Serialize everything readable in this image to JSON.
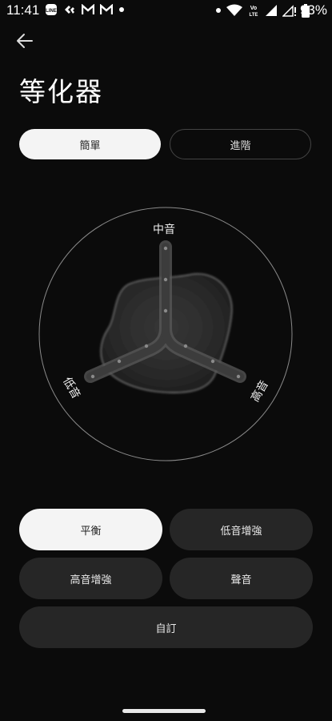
{
  "status_bar": {
    "time": "11:41",
    "battery": "93%",
    "left_icons": [
      "line-icon",
      "wallet-icon",
      "gmail-icon",
      "gmail-icon",
      "dot-icon"
    ],
    "right_icons": [
      "dot-icon",
      "wifi-icon",
      "volte-icon",
      "signal-icon",
      "signal-alert-icon",
      "battery-icon"
    ]
  },
  "header": {
    "back_icon": "arrow-left-icon",
    "title": "等化器"
  },
  "mode_tabs": {
    "simple": "簡單",
    "advanced": "進階",
    "selected": "simple"
  },
  "equalizer": {
    "mid_label": "中音",
    "bass_label": "低音",
    "treble_label": "高音"
  },
  "presets": {
    "balanced": "平衡",
    "bass_boost": "低音增強",
    "treble_boost": "高音增強",
    "vocal": "聲音",
    "custom": "自訂",
    "selected": "balanced"
  },
  "colors": {
    "background": "#0b0b0b",
    "selected_button": "#f4f4f4",
    "button": "#262626"
  }
}
